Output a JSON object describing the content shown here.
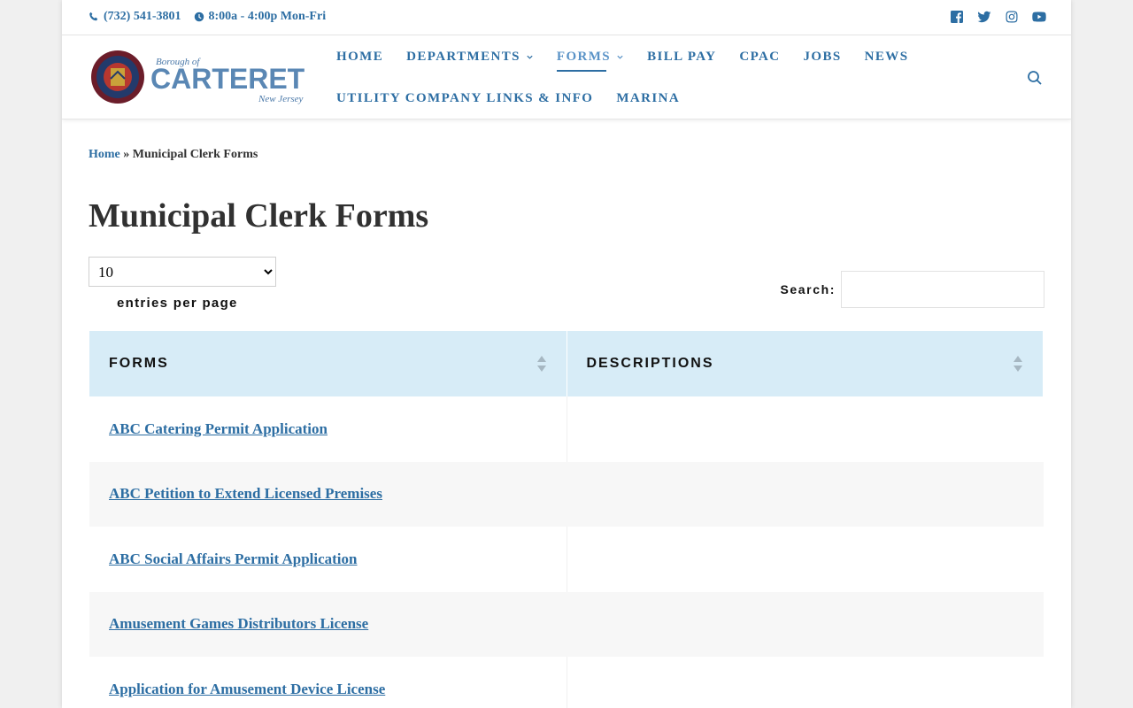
{
  "topbar": {
    "phone": "(732) 541-3801",
    "hours": "8:00a - 4:00p Mon-Fri",
    "social": [
      "facebook-icon",
      "twitter-icon",
      "instagram-icon",
      "youtube-icon"
    ]
  },
  "logo": {
    "line1": "Borough of",
    "line2": "CARTERET",
    "line3": "New Jersey",
    "seal_text": "BOROUGH OF CARTERET NEW JERSEY"
  },
  "nav": {
    "row1": [
      "HOME",
      "DEPARTMENTS",
      "FORMS",
      "BILL PAY",
      "CPAC",
      "JOBS",
      "NEWS"
    ],
    "row2": [
      "UTILITY COMPANY LINKS & INFO",
      "MARINA"
    ]
  },
  "breadcrumb": {
    "home": "Home",
    "sep": "»",
    "current": "Municipal Clerk Forms"
  },
  "page_title": "Municipal Clerk Forms",
  "entries": {
    "selected": "10",
    "label": "entries per page"
  },
  "search": {
    "label": "Search:",
    "value": ""
  },
  "table": {
    "headers": [
      "FORMS",
      "DESCRIPTIONS"
    ],
    "rows": [
      {
        "form": "ABC Catering Permit Application",
        "description": ""
      },
      {
        "form": "ABC Petition to Extend Licensed Premises",
        "description": ""
      },
      {
        "form": "ABC Social Affairs Permit Application",
        "description": ""
      },
      {
        "form": "Amusement Games Distributors License",
        "description": ""
      },
      {
        "form": "Application for Amusement Device License",
        "description": ""
      }
    ]
  },
  "colors": {
    "link": "#2d6ea3",
    "header_bg": "#d7ecf7",
    "text": "#313131"
  }
}
